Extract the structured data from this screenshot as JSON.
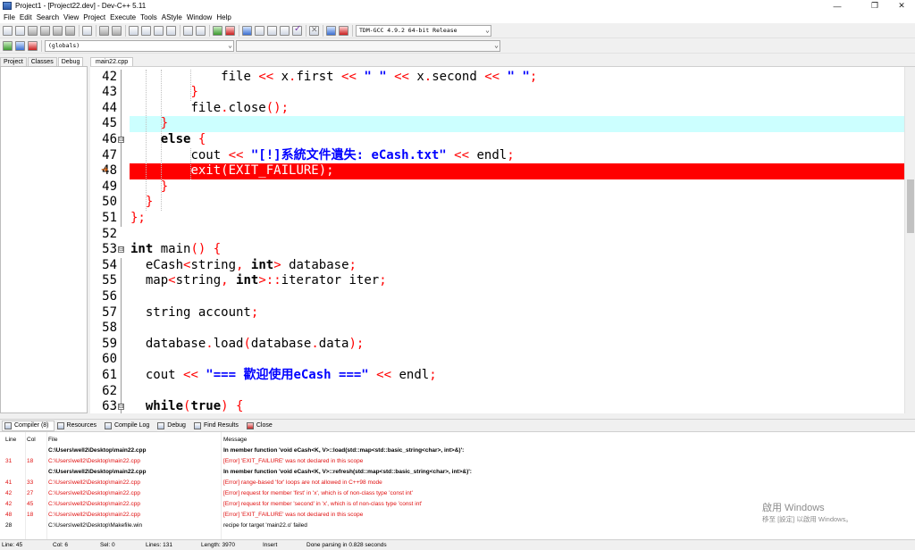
{
  "window": {
    "title": "Project1 - [Project22.dev] - Dev-C++ 5.11",
    "minimize_glyph": "—",
    "restore_glyph": "❐",
    "close_glyph": "✕"
  },
  "menu": [
    "File",
    "Edit",
    "Search",
    "View",
    "Project",
    "Execute",
    "Tools",
    "AStyle",
    "Window",
    "Help"
  ],
  "toolbar": {
    "compiler_select": "TDM-GCC 4.9.2 64-bit Release",
    "scope_select": "(globals)",
    "member_select": "",
    "dropdown_glyph": "⌄"
  },
  "left_tabs": [
    "Project",
    "Classes",
    "Debug"
  ],
  "left_active_tab": "Debug",
  "editor_tab": "main22.cpp",
  "icons": {
    "fold_open": "⊟",
    "breakpoint_arrow": "➜",
    "compiler_icon": "grid-icon",
    "resources_icon": "bars-icon",
    "compile_log_icon": "bars-icon",
    "debug_icon": "check-icon",
    "find_results_icon": "search-icon",
    "close_icon": "close-icon"
  },
  "colors": {
    "current_line": "#ccffff",
    "error_line": "#ff0000",
    "keyword": "#000000",
    "operator": "#ff0000",
    "string": "#0000ff"
  },
  "code_lines": [
    {
      "num": "42",
      "indent": "            ",
      "parts": [
        [
          "file ",
          ""
        ],
        [
          "<<",
          "op"
        ],
        [
          " x",
          ""
        ],
        [
          ".",
          "op"
        ],
        [
          "first ",
          ""
        ],
        [
          "<<",
          "op"
        ],
        [
          " \" \" ",
          "str"
        ],
        [
          "<<",
          "op"
        ],
        [
          " x",
          ""
        ],
        [
          ".",
          "op"
        ],
        [
          "second ",
          ""
        ],
        [
          "<<",
          "op"
        ],
        [
          " \" \"",
          "str"
        ],
        [
          ";",
          "op"
        ]
      ]
    },
    {
      "num": "43",
      "indent": "        ",
      "parts": [
        [
          "}",
          "op"
        ]
      ]
    },
    {
      "num": "44",
      "indent": "        ",
      "parts": [
        [
          "file",
          ""
        ],
        [
          ".",
          "op"
        ],
        [
          "close",
          ""
        ],
        [
          "();",
          "op"
        ]
      ]
    },
    {
      "num": "45",
      "indent": "    ",
      "parts": [
        [
          "}",
          "op"
        ]
      ]
    },
    {
      "num": "46",
      "indent": "    ",
      "parts": [
        [
          "else",
          "kw"
        ],
        [
          " ",
          ""
        ],
        [
          "{",
          "op"
        ]
      ]
    },
    {
      "num": "47",
      "indent": "        ",
      "parts": [
        [
          "cout ",
          ""
        ],
        [
          "<<",
          "op"
        ],
        [
          " \"[!]系統文件遺失: eCash.txt\" ",
          "str"
        ],
        [
          "<<",
          "op"
        ],
        [
          " endl",
          ""
        ],
        [
          ";",
          "op"
        ]
      ]
    },
    {
      "num": "48",
      "indent": "        ",
      "parts": [
        [
          "exit(EXIT_FAILURE);",
          "errtxt"
        ]
      ]
    },
    {
      "num": "49",
      "indent": "    ",
      "parts": [
        [
          "}",
          "op"
        ]
      ]
    },
    {
      "num": "50",
      "indent": "  ",
      "parts": [
        [
          "}",
          "op"
        ]
      ]
    },
    {
      "num": "51",
      "indent": "",
      "parts": [
        [
          "};",
          "op"
        ]
      ]
    },
    {
      "num": "52",
      "indent": "",
      "parts": []
    },
    {
      "num": "53",
      "indent": "",
      "parts": [
        [
          "int",
          "kw"
        ],
        [
          " main",
          ""
        ],
        [
          "()",
          "op"
        ],
        [
          " ",
          ""
        ],
        [
          "{",
          "op"
        ]
      ]
    },
    {
      "num": "54",
      "indent": "  ",
      "parts": [
        [
          "eCash",
          ""
        ],
        [
          "<",
          "op"
        ],
        [
          "string",
          ""
        ],
        [
          ",",
          "op"
        ],
        [
          " ",
          ""
        ],
        [
          "int",
          "kw"
        ],
        [
          ">",
          "op"
        ],
        [
          " database",
          ""
        ],
        [
          ";",
          "op"
        ]
      ]
    },
    {
      "num": "55",
      "indent": "  ",
      "parts": [
        [
          "map",
          ""
        ],
        [
          "<",
          "op"
        ],
        [
          "string",
          ""
        ],
        [
          ",",
          "op"
        ],
        [
          " ",
          ""
        ],
        [
          "int",
          "kw"
        ],
        [
          ">::",
          "op"
        ],
        [
          "iterator iter",
          ""
        ],
        [
          ";",
          "op"
        ]
      ]
    },
    {
      "num": "56",
      "indent": "",
      "parts": []
    },
    {
      "num": "57",
      "indent": "  ",
      "parts": [
        [
          "string account",
          ""
        ],
        [
          ";",
          "op"
        ]
      ]
    },
    {
      "num": "58",
      "indent": "",
      "parts": []
    },
    {
      "num": "59",
      "indent": "  ",
      "parts": [
        [
          "database",
          ""
        ],
        [
          ".",
          "op"
        ],
        [
          "load",
          ""
        ],
        [
          "(",
          "op"
        ],
        [
          "database",
          ""
        ],
        [
          ".",
          "op"
        ],
        [
          "data",
          ""
        ],
        [
          ");",
          "op"
        ]
      ]
    },
    {
      "num": "60",
      "indent": "",
      "parts": []
    },
    {
      "num": "61",
      "indent": "  ",
      "parts": [
        [
          "cout ",
          ""
        ],
        [
          "<<",
          "op"
        ],
        [
          " \"=== 歡迎使用eCash ===\" ",
          "str"
        ],
        [
          "<<",
          "op"
        ],
        [
          " endl",
          ""
        ],
        [
          ";",
          "op"
        ]
      ]
    },
    {
      "num": "62",
      "indent": "",
      "parts": []
    },
    {
      "num": "63",
      "indent": "  ",
      "parts": [
        [
          "while",
          "kw"
        ],
        [
          "(",
          "op"
        ],
        [
          "true",
          "kw"
        ],
        [
          ")",
          "op"
        ],
        [
          " ",
          ""
        ],
        [
          "{",
          "op"
        ]
      ]
    }
  ],
  "bottom_tabs": [
    {
      "label": "Compiler (8)",
      "active": true
    },
    {
      "label": "Resources",
      "active": false
    },
    {
      "label": "Compile Log",
      "active": false
    },
    {
      "label": "Debug",
      "active": false
    },
    {
      "label": "Find Results",
      "active": false
    },
    {
      "label": "Close",
      "active": false
    }
  ],
  "messages_header": {
    "line": "Line",
    "col": "Col",
    "file": "File",
    "message": "Message"
  },
  "messages": [
    {
      "line": "",
      "col": "",
      "file": "C:\\Users\\well2\\Desktop\\main22.cpp",
      "message": "In member function 'void eCash<K, V>::load(std::map<std::basic_string<char>, int>&)':",
      "style": "bold"
    },
    {
      "line": "31",
      "col": "18",
      "file": "C:\\Users\\well2\\Desktop\\main22.cpp",
      "message": "[Error] 'EXIT_FAILURE' was not declared in this scope",
      "style": "err"
    },
    {
      "line": "",
      "col": "",
      "file": "C:\\Users\\well2\\Desktop\\main22.cpp",
      "message": "In member function 'void eCash<K, V>::refresh(std::map<std::basic_string<char>, int>&)':",
      "style": "bold"
    },
    {
      "line": "41",
      "col": "33",
      "file": "C:\\Users\\well2\\Desktop\\main22.cpp",
      "message": "[Error] range-based 'for' loops are not allowed in C++98 mode",
      "style": "err"
    },
    {
      "line": "42",
      "col": "27",
      "file": "C:\\Users\\well2\\Desktop\\main22.cpp",
      "message": "[Error] request for member 'first' in 'x', which is of non-class type 'const int'",
      "style": "err"
    },
    {
      "line": "42",
      "col": "45",
      "file": "C:\\Users\\well2\\Desktop\\main22.cpp",
      "message": "[Error] request for member 'second' in 'x', which is of non-class type 'const int'",
      "style": "err"
    },
    {
      "line": "48",
      "col": "18",
      "file": "C:\\Users\\well2\\Desktop\\main22.cpp",
      "message": "[Error] 'EXIT_FAILURE' was not declared in this scope",
      "style": "err"
    },
    {
      "line": "28",
      "col": "",
      "file": "C:\\Users\\well2\\Desktop\\Makefile.win",
      "message": "recipe for target 'main22.o' failed",
      "style": "normal"
    }
  ],
  "watermark": {
    "line1": "啟用 Windows",
    "line2": "移至 [設定] 以啟用 Windows。"
  },
  "status": {
    "line": "Line:     45",
    "col": "Col:     6",
    "sel": "Sel:     0",
    "lines": "Lines:     131",
    "length": "Length:     3970",
    "mode": "Insert",
    "message": "Done parsing in 0.828 seconds"
  }
}
